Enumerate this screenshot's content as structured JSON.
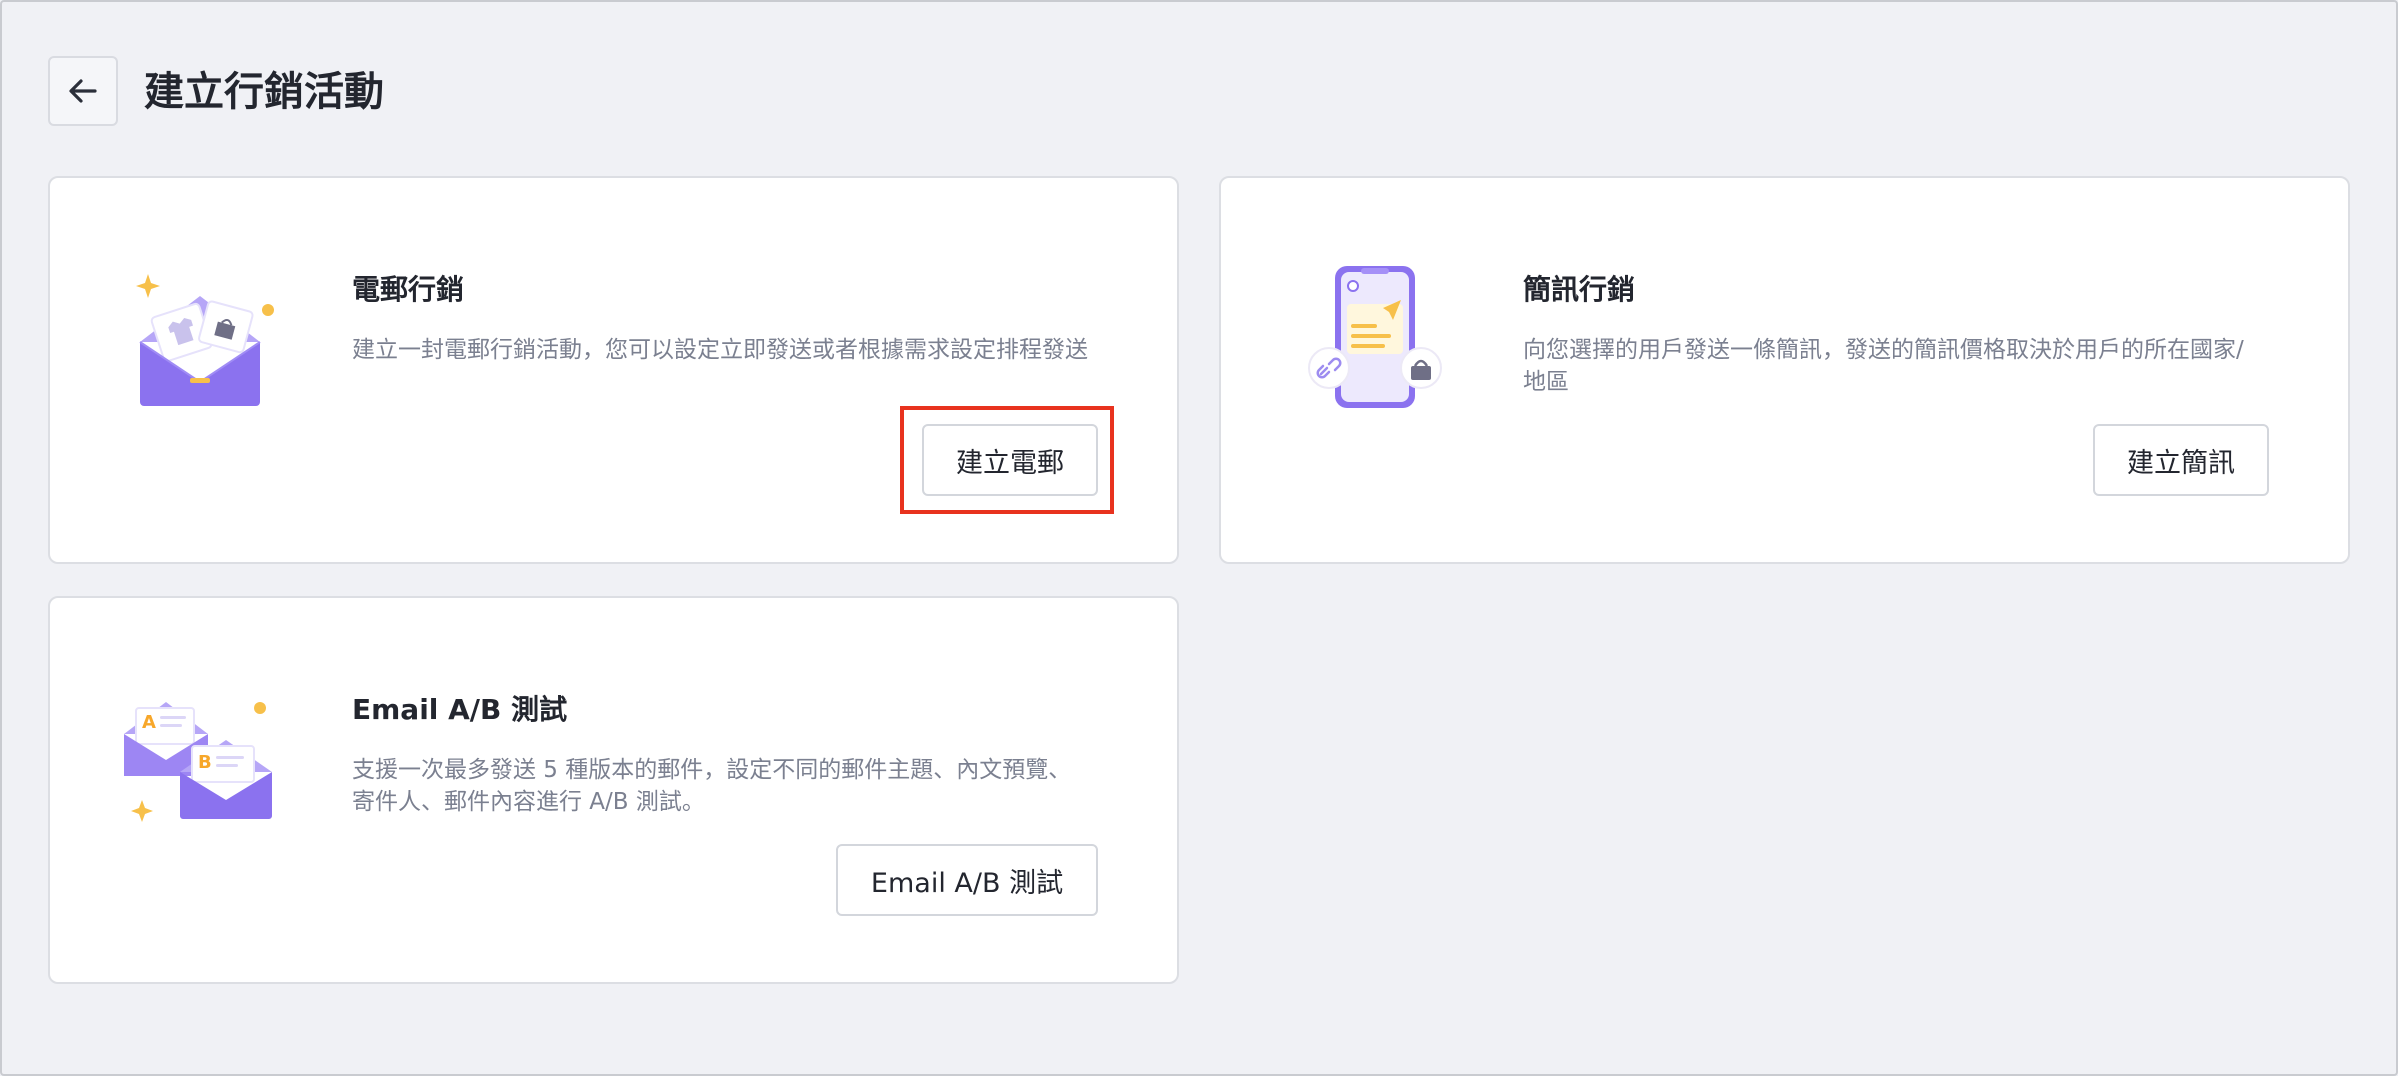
{
  "header": {
    "title": "建立行銷活動",
    "back_icon": "arrow-left-icon"
  },
  "cards": {
    "email": {
      "title": "電郵行銷",
      "description": "建立一封電郵行銷活動，您可以設定立即發送或者根據需求設定排程發送",
      "button_label": "建立電郵",
      "icon": "email-envelope-illustration",
      "highlighted": true,
      "highlight_color": "#e8321e"
    },
    "sms": {
      "title": "簡訊行銷",
      "description": "向您選擇的用戶發送一條簡訊，發送的簡訊價格取決於用戶的所在國家/地區",
      "button_label": "建立簡訊",
      "icon": "phone-sms-illustration"
    },
    "ab_test": {
      "title": "Email A/B 測試",
      "description": "支援一次最多發送 5 種版本的郵件，設定不同的郵件主題、內文預覽、寄件人、郵件內容進行 A/B 測試。",
      "button_label": "Email A/B 測試",
      "icon": "ab-envelopes-illustration"
    }
  },
  "colors": {
    "background": "#f0f1f5",
    "card": "#ffffff",
    "accent_purple": "#8b72ef",
    "accent_yellow": "#f7c04a",
    "highlight_red": "#e8321e"
  }
}
